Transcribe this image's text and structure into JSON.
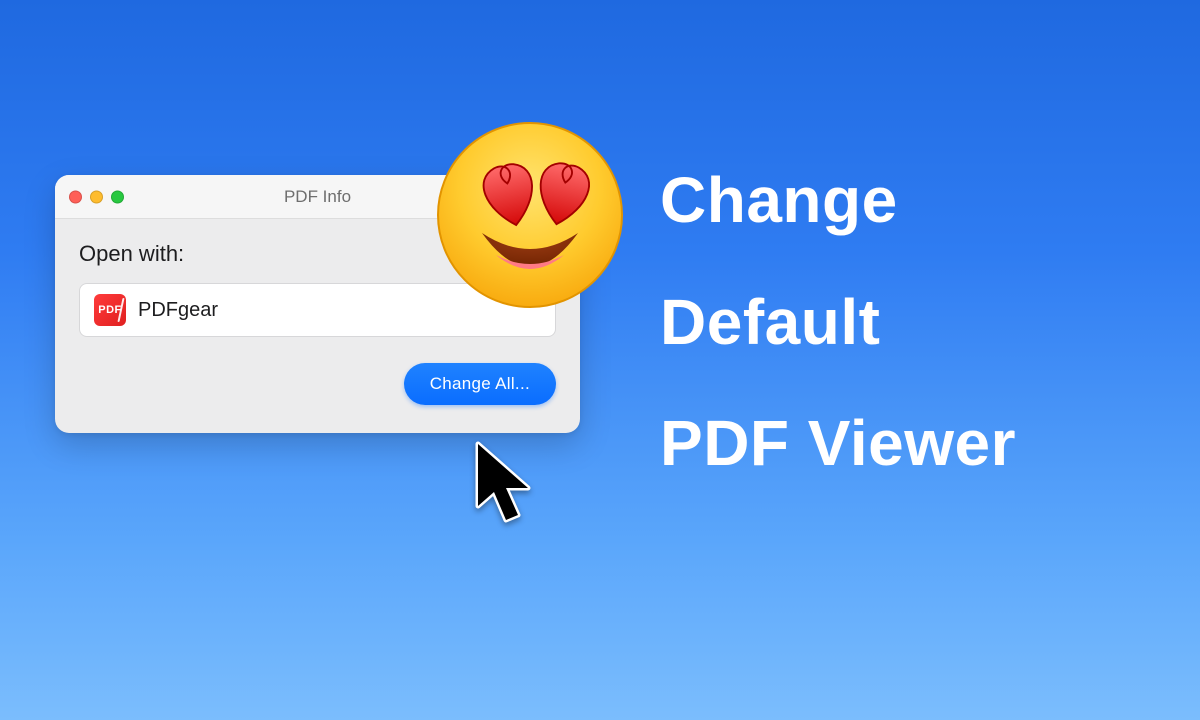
{
  "headline": {
    "line1": "Change",
    "line2": "Default",
    "line3": "PDF Viewer"
  },
  "window": {
    "title": "PDF Info",
    "section_label": "Open with:",
    "app": {
      "icon_text": "PDF",
      "name": "PDFgear"
    },
    "change_all_label": "Change All..."
  },
  "colors": {
    "accent": "#0a6dff",
    "app_icon": "#e02020"
  },
  "emoji_name": "smiling-face-with-heart-eyes"
}
